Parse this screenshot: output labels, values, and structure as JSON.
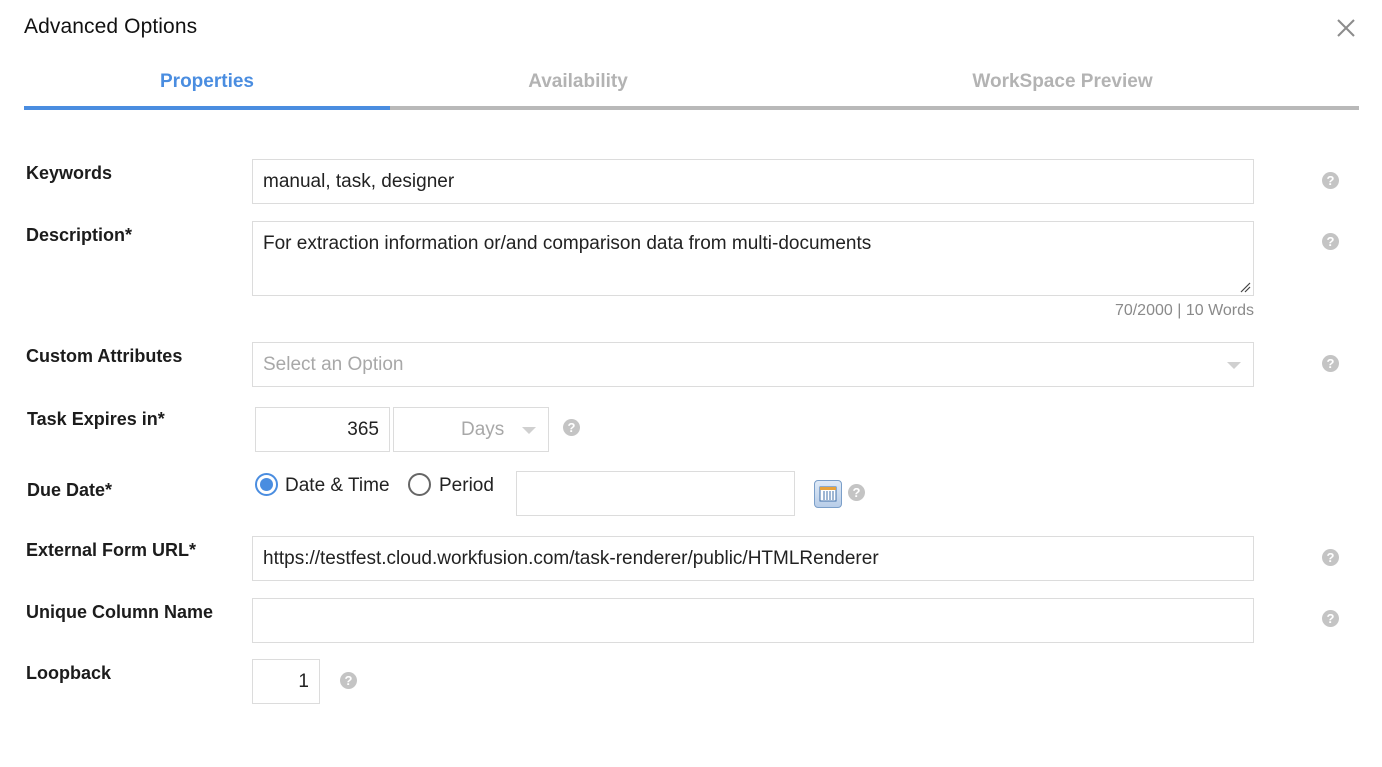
{
  "dialog": {
    "title": "Advanced Options",
    "close_icon": "close-icon"
  },
  "tabs": [
    {
      "label": "Properties",
      "active": true
    },
    {
      "label": "Availability",
      "active": false
    },
    {
      "label": "WorkSpace Preview",
      "active": false
    }
  ],
  "form": {
    "keywords": {
      "label": "Keywords",
      "value": "manual, task, designer"
    },
    "description": {
      "label": "Description*",
      "value": "For extraction information or/and comparison data from multi-documents",
      "counter": "70/2000 | 10 Words"
    },
    "custom_attributes": {
      "label": "Custom Attributes",
      "placeholder": "Select an Option"
    },
    "task_expires": {
      "label": "Task Expires in*",
      "value": "365",
      "unit": "Days"
    },
    "due_date": {
      "label": "Due Date*",
      "options": [
        "Date & Time",
        "Period"
      ],
      "selected": "Date & Time",
      "value": ""
    },
    "external_form_url": {
      "label": "External Form URL*",
      "value": "https://testfest.cloud.workfusion.com/task-renderer/public/HTMLRenderer"
    },
    "unique_column_name": {
      "label": "Unique Column Name",
      "value": ""
    },
    "loopback": {
      "label": "Loopback",
      "value": "1"
    },
    "help_glyph": "?"
  },
  "colors": {
    "accent": "#4a8de0",
    "tab_inactive": "#b3b3b3",
    "help_icon": "#c4c4c4",
    "border": "#dcdcdc"
  }
}
